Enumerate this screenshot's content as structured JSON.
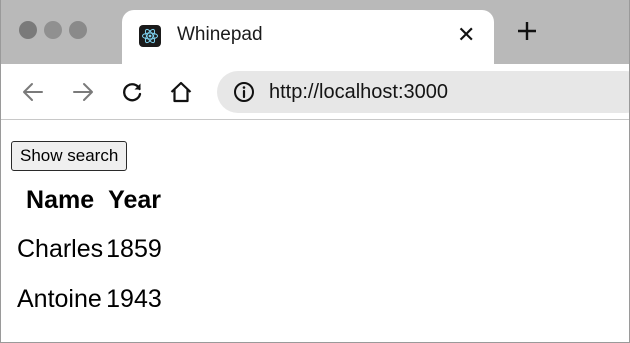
{
  "tab": {
    "title": "Whinepad",
    "close_label": "✕"
  },
  "address_bar": {
    "url": "http://localhost:3000"
  },
  "page": {
    "show_search_label": "Show search",
    "table": {
      "headers": [
        "Name",
        "Year"
      ],
      "rows": [
        [
          "Charles",
          "1859"
        ],
        [
          "Antoine",
          "1943"
        ]
      ]
    }
  },
  "icons": {
    "favicon": "react-atom-icon",
    "new_tab": "plus-icon",
    "back": "arrow-left-icon",
    "forward": "arrow-right-icon",
    "reload": "reload-icon",
    "home": "home-icon",
    "info": "info-icon"
  },
  "colors": {
    "tabstrip_bg": "#b9b9b9",
    "omnibox_bg": "#e7e7e7",
    "button_bg": "#efefef"
  }
}
